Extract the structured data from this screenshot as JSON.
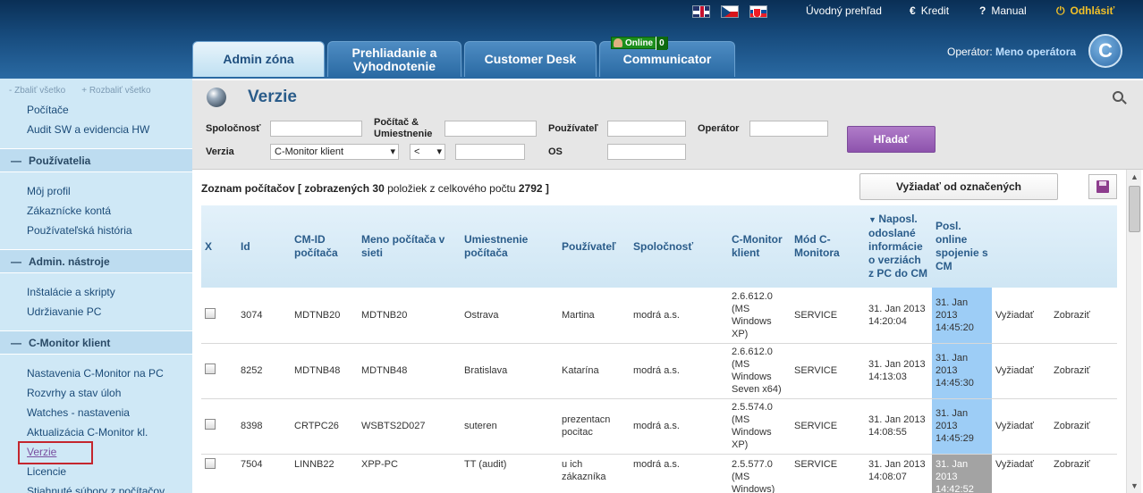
{
  "header": {
    "nav": {
      "overview": "Úvodný prehľad",
      "credit": "Kredit",
      "manual": "Manual",
      "logout": "Odhlásiť"
    },
    "tabs": [
      {
        "label": "Admin zóna"
      },
      {
        "label": "Prehliadanie a Vyhodnotenie"
      },
      {
        "label": "Customer Desk"
      },
      {
        "label": "Communicator"
      }
    ],
    "online_badge": {
      "label": "Online",
      "count": "0"
    },
    "operator_label": "Operátor:",
    "operator_name": "Meno operátora",
    "logo_letter": "C"
  },
  "sidebar": {
    "collapse_all": "- Zbaliť všetko",
    "expand_all": "+ Rozbaliť všetko",
    "items_top": [
      "Počítače",
      "Audit SW a evidencia HW"
    ],
    "sections": [
      {
        "title": "Používatelia",
        "items": [
          "Môj profil",
          "Zákaznícke kontá",
          "Používateľská história"
        ]
      },
      {
        "title": "Admin. nástroje",
        "items": [
          "Inštalácie a skripty",
          "Udržiavanie PC"
        ]
      },
      {
        "title": "C-Monitor klient",
        "items": [
          "Nastavenia C-Monitor na PC",
          "Rozvrhy a stav úloh",
          "Watches - nastavenia",
          "Aktualizácia C-Monitor kl.",
          "Verzie",
          "Licencie",
          "Stiahnuté súbory z počítačov"
        ]
      }
    ]
  },
  "main": {
    "title": "Verzie",
    "filters": {
      "company_label": "Spoločnosť",
      "computer_label": "Počítač & Umiestnenie",
      "user_label": "Používateľ",
      "operator_label": "Operátor",
      "version_label": "Verzia",
      "version_value": "C-Monitor klient",
      "operator_cmp": "<",
      "os_label": "OS",
      "search_button": "Hľadať"
    },
    "list_info": {
      "prefix": "Zoznam počítačov",
      "shown_prefix": "[ zobrazených",
      "shown": "30",
      "middle": "položiek z celkového počtu",
      "total": "2792",
      "suffix": "]"
    },
    "request_selected": "Vyžiadať od označených",
    "table": {
      "headers": [
        "X",
        "Id",
        "CM-ID počítača",
        "Meno počítača v sieti",
        "Umiestnenie počítača",
        "Používateľ",
        "Spoločnosť",
        "C-Monitor klient",
        "Mód C-Monitora",
        "Naposl. odoslané informácie o verziách z PC do CM",
        "Posl. online spojenie s CM",
        "",
        ""
      ],
      "rows": [
        {
          "id": "3074",
          "cmid": "MDTNB20",
          "name": "MDTNB20",
          "location": "Ostrava",
          "user": "Martina",
          "company": "modrá a.s.",
          "client": "2.6.612.0 (MS Windows XP)",
          "mode": "SERVICE",
          "last_info": "31. Jan 2013 14:20:04",
          "online": "31. Jan 2013 14:45:20",
          "request": "Vyžiadať",
          "show": "Zobraziť",
          "status_color": "#9dcdf6"
        },
        {
          "id": "8252",
          "cmid": "MDTNB48",
          "name": "MDTNB48",
          "location": "Bratislava",
          "user": "Katarína",
          "company": "modrá a.s.",
          "client": "2.6.612.0 (MS Windows Seven x64)",
          "mode": "SERVICE",
          "last_info": "31. Jan 2013 14:13:03",
          "online": "31. Jan 2013 14:45:30",
          "request": "Vyžiadať",
          "show": "Zobraziť",
          "status_color": "#9dcdf6"
        },
        {
          "id": "8398",
          "cmid": "CRTPC26",
          "name": "WSBTS2D027",
          "location": "suteren",
          "user": "prezentacn pocitac",
          "company": "modrá a.s.",
          "client": "2.5.574.0 (MS Windows XP)",
          "mode": "SERVICE",
          "last_info": "31. Jan 2013 14:08:55",
          "online": "31. Jan 2013 14:45:29",
          "request": "Vyžiadať",
          "show": "Zobraziť",
          "status_color": "#9dcdf6"
        },
        {
          "id": "7504",
          "cmid": "LINNB22",
          "name": "XPP-PC",
          "location": "TT (audit)",
          "user": "u ich zákazníka",
          "company": "modrá a.s.",
          "client": "2.5.577.0 (MS Windows)",
          "mode": "SERVICE",
          "last_info": "31. Jan 2013 14:08:07",
          "online": "31. Jan 2013 14:42:52",
          "request": "Vyžiadať",
          "show": "Zobraziť",
          "status_color": "#a3a3a3"
        }
      ]
    }
  }
}
